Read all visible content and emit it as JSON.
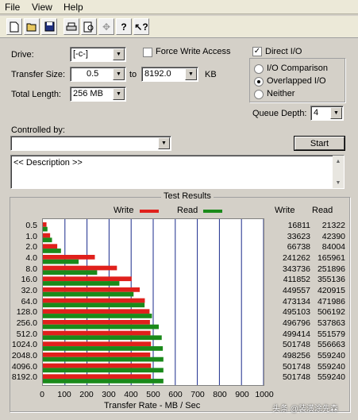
{
  "menu": {
    "items": [
      "File",
      "View",
      "Help"
    ]
  },
  "toolbar": {
    "icons": [
      "new-icon",
      "open-icon",
      "save-icon",
      "print-icon",
      "print-preview-icon",
      "move-icon",
      "help-icon",
      "context-help-icon"
    ]
  },
  "form": {
    "drive_label": "Drive:",
    "drive_value": "[-c-]",
    "transfer_size_label": "Transfer Size:",
    "transfer_min": "0.5",
    "to_label": "to",
    "transfer_max": "8192.0",
    "unit": "KB",
    "total_length_label": "Total Length:",
    "total_length_value": "256 MB",
    "force_write_label": "Force Write Access",
    "direct_io_label": "Direct I/O",
    "io_comparison_label": "I/O Comparison",
    "overlapped_io_label": "Overlapped I/O",
    "neither_label": "Neither",
    "queue_depth_label": "Queue Depth:",
    "queue_depth_value": "4",
    "controlled_by_label": "Controlled by:",
    "controlled_by_value": "",
    "start_label": "Start",
    "description": "<< Description >>"
  },
  "results": {
    "title": "Test Results",
    "write_legend": "Write",
    "read_legend": "Read",
    "write_header": "Write",
    "read_header": "Read",
    "write_color": "#e0201c",
    "read_color": "#1a8a1a"
  },
  "chart_data": {
    "type": "bar",
    "xlabel": "Transfer Rate - MB / Sec",
    "xlim": [
      0,
      1000
    ],
    "xticks": [
      0,
      100,
      200,
      300,
      400,
      500,
      600,
      700,
      800,
      900,
      1000
    ],
    "categories": [
      "0.5",
      "1.0",
      "2.0",
      "4.0",
      "8.0",
      "16.0",
      "32.0",
      "64.0",
      "128.0",
      "256.0",
      "512.0",
      "1024.0",
      "2048.0",
      "4096.0",
      "8192.0"
    ],
    "series": [
      {
        "name": "Write",
        "values": [
          16811,
          33623,
          66738,
          241262,
          343736,
          411852,
          449557,
          473134,
          495103,
          496796,
          499414,
          501748,
          498256,
          501748,
          501748
        ]
      },
      {
        "name": "Read",
        "values": [
          21322,
          42390,
          84004,
          165961,
          251896,
          355136,
          420915,
          471986,
          506192,
          537863,
          551579,
          556663,
          559240,
          559240,
          559240
        ]
      }
    ]
  },
  "watermark": "头条 @装潢涂先森"
}
